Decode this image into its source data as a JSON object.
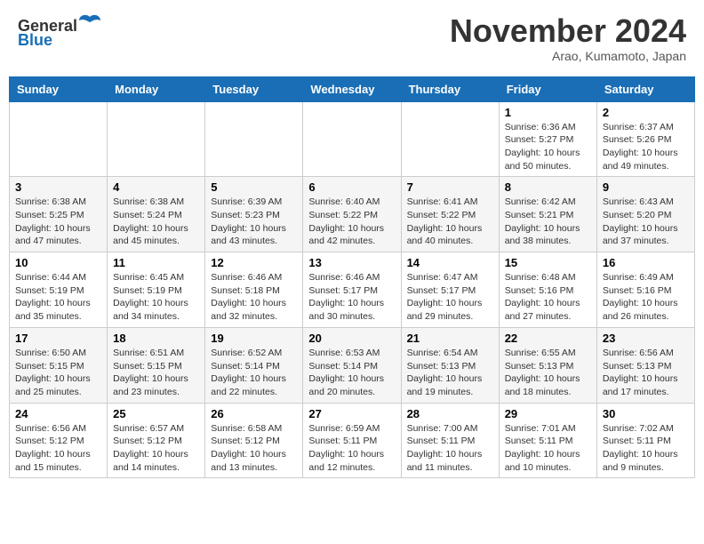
{
  "header": {
    "logo_line1": "General",
    "logo_line2": "Blue",
    "month_title": "November 2024",
    "location": "Arao, Kumamoto, Japan"
  },
  "weekdays": [
    "Sunday",
    "Monday",
    "Tuesday",
    "Wednesday",
    "Thursday",
    "Friday",
    "Saturday"
  ],
  "weeks": [
    [
      {
        "day": "",
        "info": ""
      },
      {
        "day": "",
        "info": ""
      },
      {
        "day": "",
        "info": ""
      },
      {
        "day": "",
        "info": ""
      },
      {
        "day": "",
        "info": ""
      },
      {
        "day": "1",
        "info": "Sunrise: 6:36 AM\nSunset: 5:27 PM\nDaylight: 10 hours\nand 50 minutes."
      },
      {
        "day": "2",
        "info": "Sunrise: 6:37 AM\nSunset: 5:26 PM\nDaylight: 10 hours\nand 49 minutes."
      }
    ],
    [
      {
        "day": "3",
        "info": "Sunrise: 6:38 AM\nSunset: 5:25 PM\nDaylight: 10 hours\nand 47 minutes."
      },
      {
        "day": "4",
        "info": "Sunrise: 6:38 AM\nSunset: 5:24 PM\nDaylight: 10 hours\nand 45 minutes."
      },
      {
        "day": "5",
        "info": "Sunrise: 6:39 AM\nSunset: 5:23 PM\nDaylight: 10 hours\nand 43 minutes."
      },
      {
        "day": "6",
        "info": "Sunrise: 6:40 AM\nSunset: 5:22 PM\nDaylight: 10 hours\nand 42 minutes."
      },
      {
        "day": "7",
        "info": "Sunrise: 6:41 AM\nSunset: 5:22 PM\nDaylight: 10 hours\nand 40 minutes."
      },
      {
        "day": "8",
        "info": "Sunrise: 6:42 AM\nSunset: 5:21 PM\nDaylight: 10 hours\nand 38 minutes."
      },
      {
        "day": "9",
        "info": "Sunrise: 6:43 AM\nSunset: 5:20 PM\nDaylight: 10 hours\nand 37 minutes."
      }
    ],
    [
      {
        "day": "10",
        "info": "Sunrise: 6:44 AM\nSunset: 5:19 PM\nDaylight: 10 hours\nand 35 minutes."
      },
      {
        "day": "11",
        "info": "Sunrise: 6:45 AM\nSunset: 5:19 PM\nDaylight: 10 hours\nand 34 minutes."
      },
      {
        "day": "12",
        "info": "Sunrise: 6:46 AM\nSunset: 5:18 PM\nDaylight: 10 hours\nand 32 minutes."
      },
      {
        "day": "13",
        "info": "Sunrise: 6:46 AM\nSunset: 5:17 PM\nDaylight: 10 hours\nand 30 minutes."
      },
      {
        "day": "14",
        "info": "Sunrise: 6:47 AM\nSunset: 5:17 PM\nDaylight: 10 hours\nand 29 minutes."
      },
      {
        "day": "15",
        "info": "Sunrise: 6:48 AM\nSunset: 5:16 PM\nDaylight: 10 hours\nand 27 minutes."
      },
      {
        "day": "16",
        "info": "Sunrise: 6:49 AM\nSunset: 5:16 PM\nDaylight: 10 hours\nand 26 minutes."
      }
    ],
    [
      {
        "day": "17",
        "info": "Sunrise: 6:50 AM\nSunset: 5:15 PM\nDaylight: 10 hours\nand 25 minutes."
      },
      {
        "day": "18",
        "info": "Sunrise: 6:51 AM\nSunset: 5:15 PM\nDaylight: 10 hours\nand 23 minutes."
      },
      {
        "day": "19",
        "info": "Sunrise: 6:52 AM\nSunset: 5:14 PM\nDaylight: 10 hours\nand 22 minutes."
      },
      {
        "day": "20",
        "info": "Sunrise: 6:53 AM\nSunset: 5:14 PM\nDaylight: 10 hours\nand 20 minutes."
      },
      {
        "day": "21",
        "info": "Sunrise: 6:54 AM\nSunset: 5:13 PM\nDaylight: 10 hours\nand 19 minutes."
      },
      {
        "day": "22",
        "info": "Sunrise: 6:55 AM\nSunset: 5:13 PM\nDaylight: 10 hours\nand 18 minutes."
      },
      {
        "day": "23",
        "info": "Sunrise: 6:56 AM\nSunset: 5:13 PM\nDaylight: 10 hours\nand 17 minutes."
      }
    ],
    [
      {
        "day": "24",
        "info": "Sunrise: 6:56 AM\nSunset: 5:12 PM\nDaylight: 10 hours\nand 15 minutes."
      },
      {
        "day": "25",
        "info": "Sunrise: 6:57 AM\nSunset: 5:12 PM\nDaylight: 10 hours\nand 14 minutes."
      },
      {
        "day": "26",
        "info": "Sunrise: 6:58 AM\nSunset: 5:12 PM\nDaylight: 10 hours\nand 13 minutes."
      },
      {
        "day": "27",
        "info": "Sunrise: 6:59 AM\nSunset: 5:11 PM\nDaylight: 10 hours\nand 12 minutes."
      },
      {
        "day": "28",
        "info": "Sunrise: 7:00 AM\nSunset: 5:11 PM\nDaylight: 10 hours\nand 11 minutes."
      },
      {
        "day": "29",
        "info": "Sunrise: 7:01 AM\nSunset: 5:11 PM\nDaylight: 10 hours\nand 10 minutes."
      },
      {
        "day": "30",
        "info": "Sunrise: 7:02 AM\nSunset: 5:11 PM\nDaylight: 10 hours\nand 9 minutes."
      }
    ]
  ]
}
